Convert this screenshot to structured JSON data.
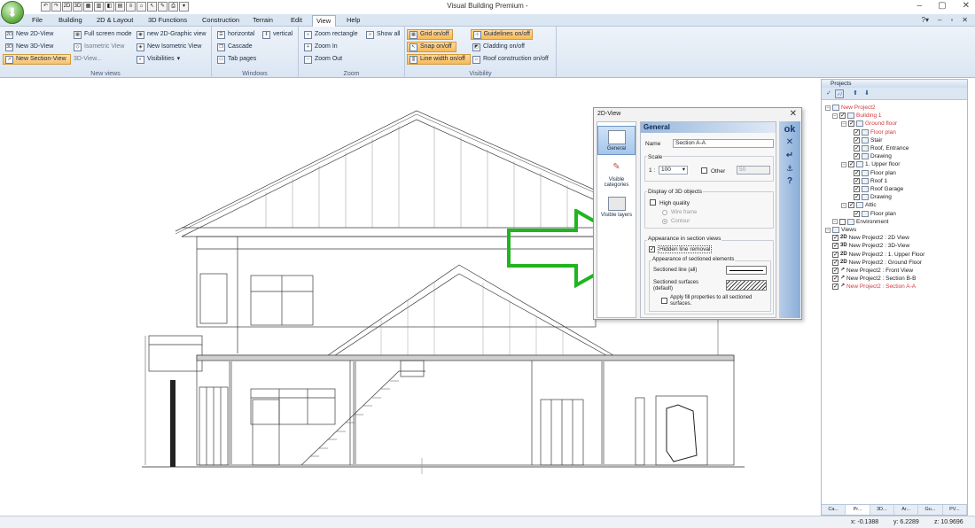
{
  "window": {
    "title": "Visual Building Premium -",
    "controls": [
      "–",
      "▢",
      "✕"
    ]
  },
  "menu": {
    "tabs": [
      "File",
      "Building",
      "2D & Layout",
      "3D Functions",
      "Construction",
      "Terrain",
      "Edit",
      "View",
      "Help"
    ],
    "active": "View"
  },
  "ribbon": {
    "new_views": {
      "label": "New views",
      "new_2d": "New 2D-View",
      "new_3d": "New 3D-View",
      "new_section": "New Section-View",
      "full_screen": "Full screen mode",
      "isometric": "Isometric View",
      "view_3d": "3D-View...",
      "new_2d_graphic": "new 2D-Graphic view",
      "new_isometric": "New Isometric View",
      "visibilities": "Visibilities"
    },
    "windows": {
      "label": "Windows",
      "horizontal": "horizontal",
      "vertical": "vertical",
      "cascade": "Cascade",
      "tab_pages": "Tab pages"
    },
    "zoom": {
      "label": "Zoom",
      "zoom_rectangle": "Zoom rectangle",
      "show_all": "Show all",
      "zoom_in": "Zoom In",
      "zoom_out": "Zoom Out"
    },
    "visibility": {
      "label": "Visibility",
      "grid": "Grid on/off",
      "snap": "Snap on/off",
      "line_width": "Line width on/off",
      "guidelines": "Guidelines on/off",
      "cladding": "Cladding on/off",
      "roof_construction": "Roof construction on/off"
    }
  },
  "dialog": {
    "title": "2D-View",
    "categories": [
      "General",
      "Visible categories",
      "Visible layers"
    ],
    "header": "General",
    "name_label": "Name",
    "name_value": "Section A-A",
    "scale_label": "Scale",
    "scale_prefix": "1 :",
    "scale_value": "100",
    "other_label": "Other",
    "other_value": "50",
    "display_3d_label": "Display of 3D objects",
    "high_quality": "High quality",
    "wire_frame": "Wire frame",
    "contour": "Contour",
    "appearance_label": "Appearance in section views",
    "hidden_line": "Hidden line removal",
    "sectioned_elements_label": "Appearance of sectioned elements",
    "sectioned_line": "Sectioned line (all)",
    "sectioned_surfaces": "Sectioned surfaces",
    "sectioned_default": "(default)",
    "apply_fill": "Apply fill properties to all sectioned",
    "apply_fill_2": "surfaces.",
    "side_buttons": [
      "ok",
      "✕",
      "↵",
      "⚓",
      "?"
    ]
  },
  "projects": {
    "title": "Projects",
    "tree": [
      {
        "label": "New Project2",
        "level": 0,
        "color": "red"
      },
      {
        "label": "Building 1",
        "level": 1,
        "color": "red"
      },
      {
        "label": "Ground floor",
        "level": 2,
        "color": "red"
      },
      {
        "label": "Floor plan",
        "level": 3,
        "color": "red"
      },
      {
        "label": "Stair",
        "level": 3,
        "color": ""
      },
      {
        "label": "Roof, Entrance",
        "level": 3,
        "color": ""
      },
      {
        "label": "Drawing",
        "level": 3,
        "color": ""
      },
      {
        "label": "1. Upper floor",
        "level": 2,
        "color": ""
      },
      {
        "label": "Floor plan",
        "level": 3,
        "color": ""
      },
      {
        "label": "Roof 1",
        "level": 3,
        "color": ""
      },
      {
        "label": "Roof Garage",
        "level": 3,
        "color": ""
      },
      {
        "label": "Drawing",
        "level": 3,
        "color": ""
      },
      {
        "label": "Attic",
        "level": 2,
        "color": ""
      },
      {
        "label": "Floor plan",
        "level": 3,
        "color": ""
      },
      {
        "label": "Environment",
        "level": 1,
        "color": ""
      },
      {
        "label": "Views",
        "level": 0,
        "color": ""
      },
      {
        "label": "New Project2 : 2D View",
        "level": 1,
        "color": "",
        "tag": "2D"
      },
      {
        "label": "New Project2 : 3D-View",
        "level": 1,
        "color": "",
        "tag": "3D"
      },
      {
        "label": "New Project2 : 1. Upper Floor",
        "level": 1,
        "color": "",
        "tag": "2D"
      },
      {
        "label": "New Project2 : Ground Floor",
        "level": 1,
        "color": "",
        "tag": "2D"
      },
      {
        "label": "New Project2 : Front View",
        "level": 1,
        "color": "",
        "tag": "↗"
      },
      {
        "label": "New Project2 : Section B-B",
        "level": 1,
        "color": "",
        "tag": "↗"
      },
      {
        "label": "New Project2 : Section A-A",
        "level": 1,
        "color": "red",
        "tag": "↗"
      }
    ],
    "bottom_tabs": [
      "Ca...",
      "Pr...",
      "3D...",
      "Ar...",
      "Gu...",
      "PV..."
    ]
  },
  "status": {
    "x": "x: -0.1388",
    "y": "y: 6.2289",
    "z": "z: 10.9696"
  }
}
